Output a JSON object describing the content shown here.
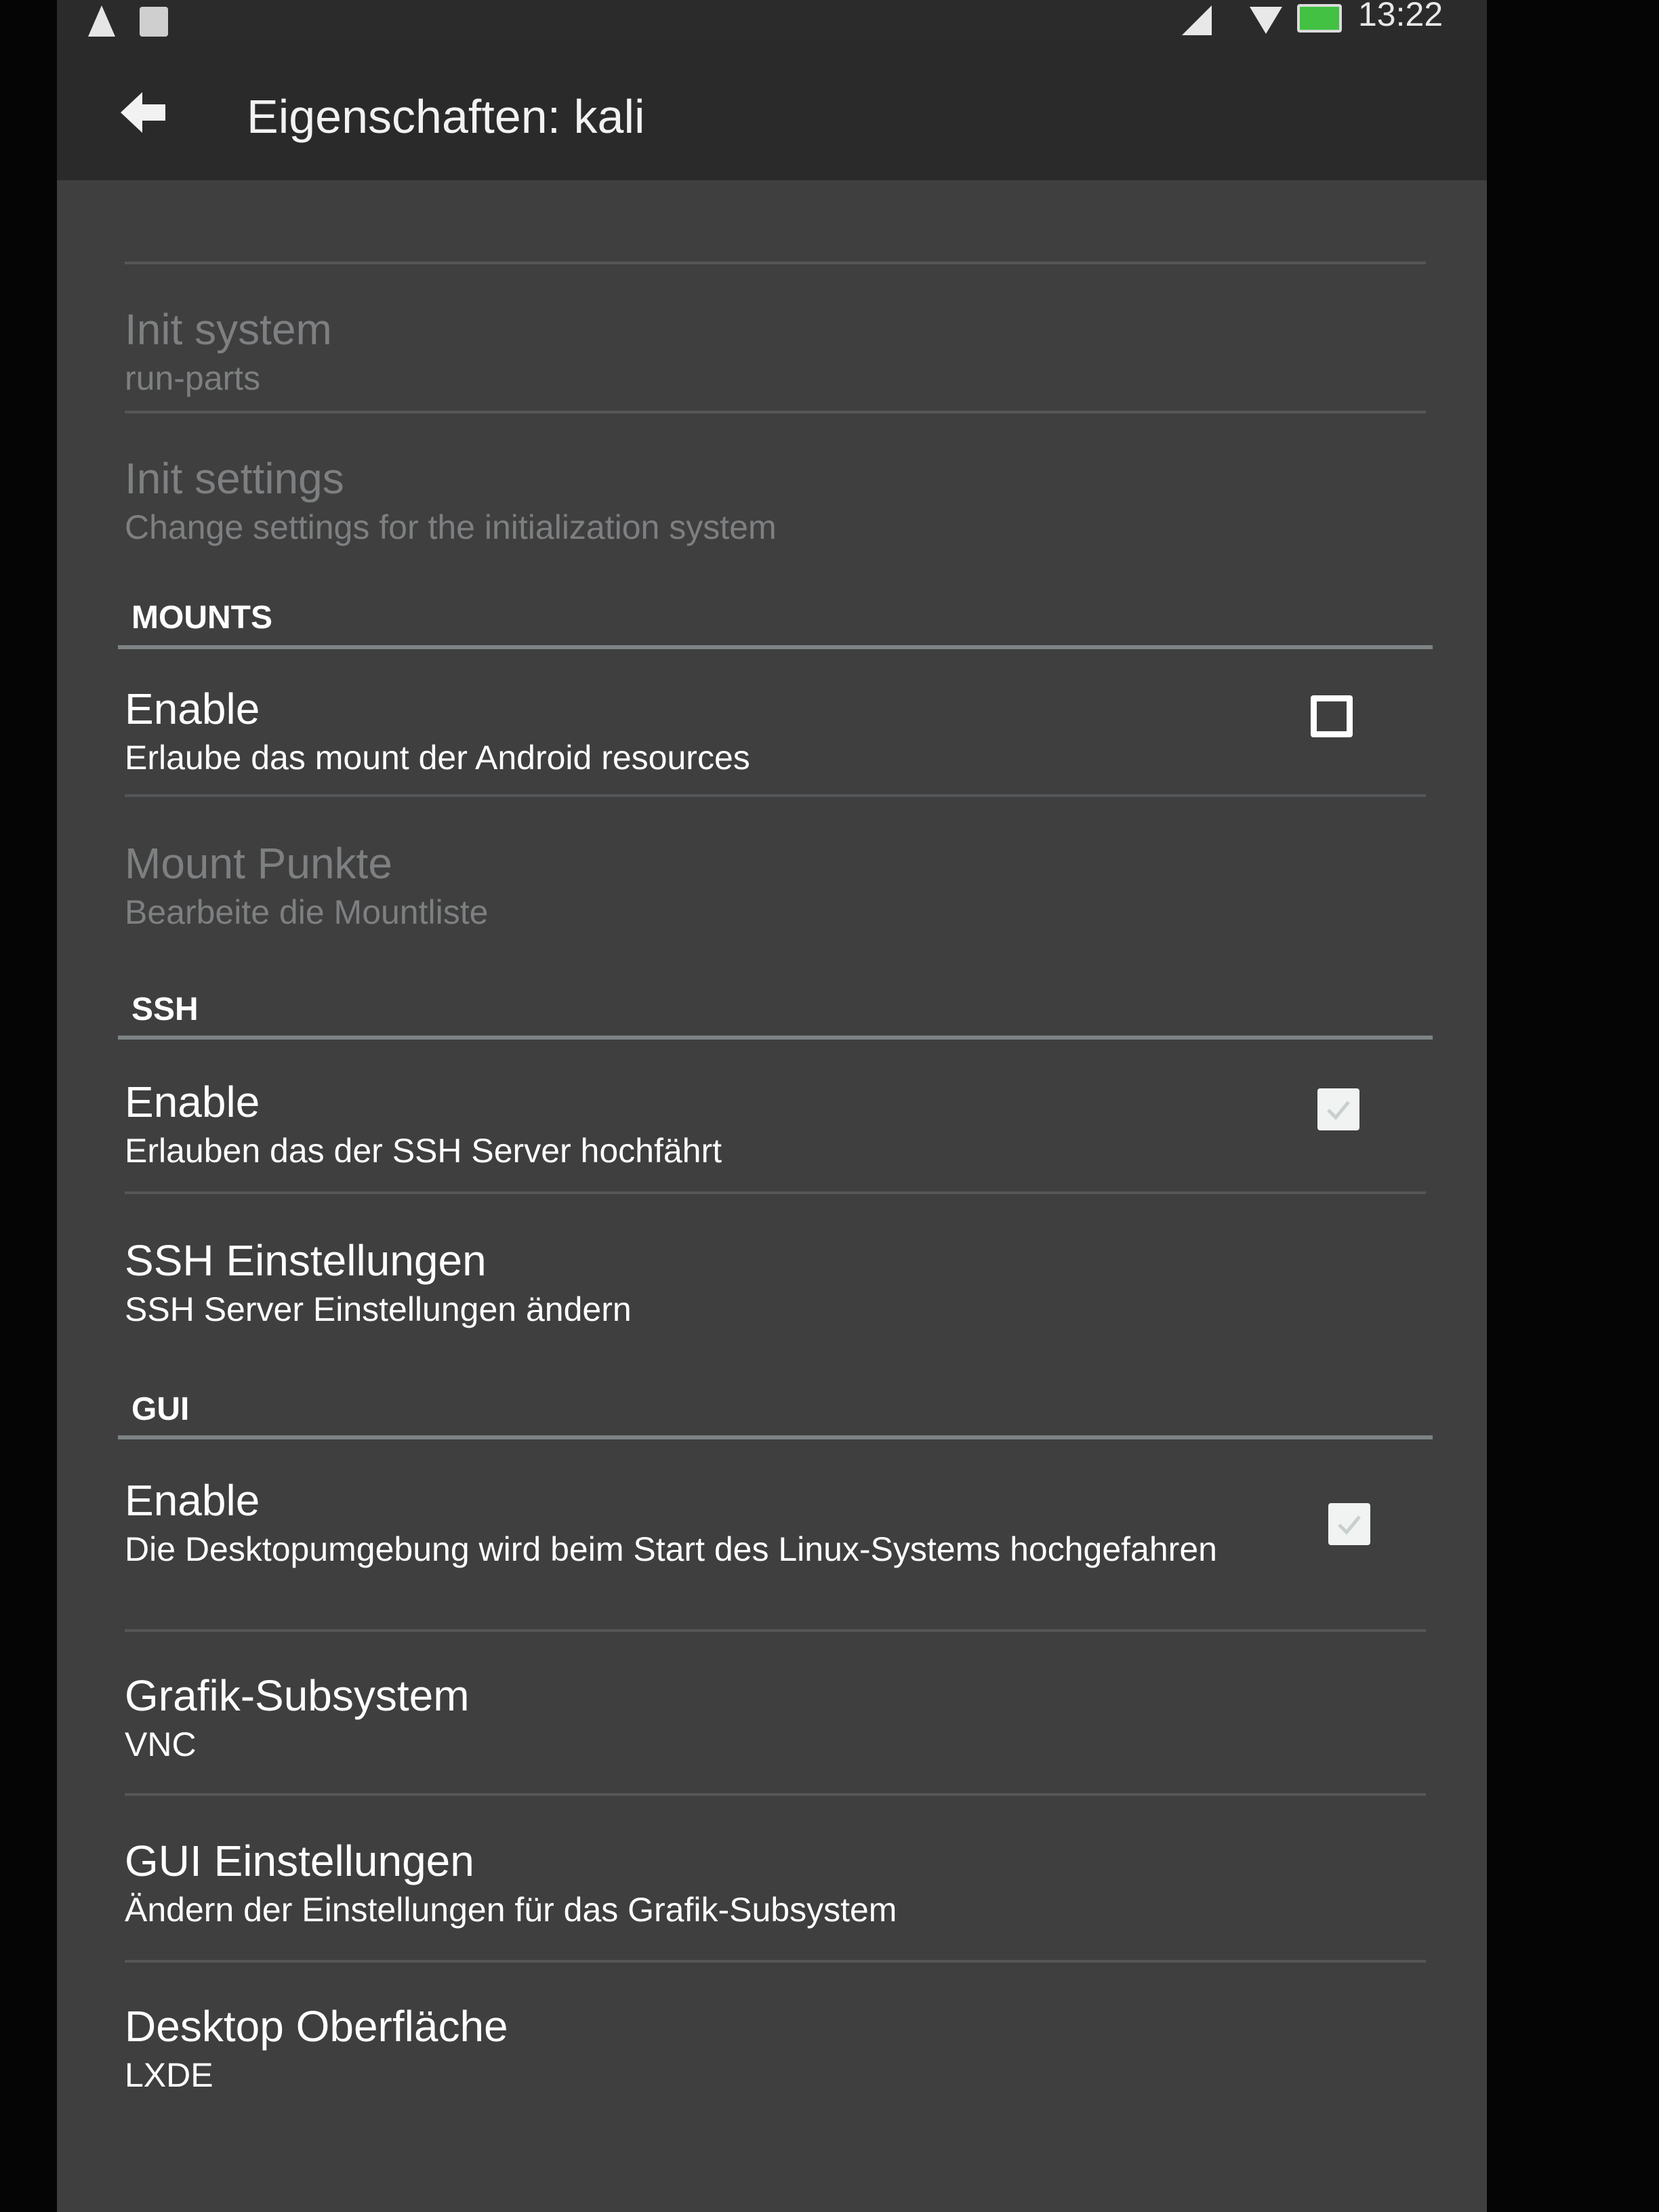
{
  "status_bar": {
    "time": "13:22"
  },
  "app_bar": {
    "title": "Eigenschaften: kali"
  },
  "preferences": {
    "init_system": {
      "title": "Init system",
      "summary": "run-parts"
    },
    "init_settings": {
      "title": "Init settings",
      "summary": "Change settings for the initialization system"
    },
    "mounts": {
      "header": "MOUNTS",
      "enable": {
        "title": "Enable",
        "summary": "Erlaube das mount der Android resources",
        "checked": false
      },
      "mount_points": {
        "title": "Mount Punkte",
        "summary": "Bearbeite die Mountliste"
      }
    },
    "ssh": {
      "header": "SSH",
      "enable": {
        "title": "Enable",
        "summary": "Erlauben das der SSH Server hochfährt",
        "checked": true
      },
      "settings": {
        "title": "SSH Einstellungen",
        "summary": "SSH Server Einstellungen ändern"
      }
    },
    "gui": {
      "header": "GUI",
      "enable": {
        "title": "Enable",
        "summary": "Die Desktopumgebung wird beim Start des Linux-Systems hochgefahren",
        "checked": true
      },
      "graphics_subsystem": {
        "title": "Grafik-Subsystem",
        "summary": "VNC"
      },
      "settings": {
        "title": "GUI Einstellungen",
        "summary": "Ändern der Einstellungen für das Grafik-Subsystem"
      },
      "desktop": {
        "title": "Desktop Oberfläche",
        "summary": "LXDE"
      }
    }
  }
}
